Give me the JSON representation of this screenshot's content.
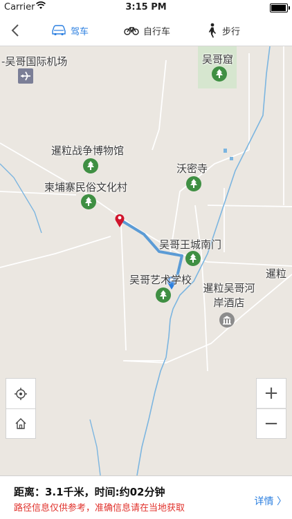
{
  "status_bar": {
    "carrier": "Carrier",
    "time": "3:15 PM",
    "battery_level": 0.95
  },
  "nav": {
    "tabs": [
      {
        "label": "驾车",
        "icon": "car-icon",
        "active": true
      },
      {
        "label": "自行车",
        "icon": "bicycle-icon",
        "active": false
      },
      {
        "label": "步行",
        "icon": "walking-person-icon",
        "active": false
      }
    ]
  },
  "map": {
    "labels": {
      "airport": "-吴哥国际机场",
      "angkor_wat": "吴哥窟",
      "war_museum": "暹粒战争博物馆",
      "wat_thmei": "沃密寺",
      "cambodian_village": "柬埔寨民俗文化村",
      "south_gate": "吴哥王城南门",
      "art_school": "吴哥艺术学校",
      "river_hotel": "暹粒吴哥河岸酒店",
      "siem_reap": "暹粒"
    },
    "controls": {
      "zoom_in": "+",
      "zoom_out": "−"
    },
    "route_color": "#5b9bd5",
    "destination_pin_color": "#d0142c",
    "origin_pin_color": "#2b7fe0"
  },
  "info": {
    "distance": "距离：3.1千米，时间:约02分钟",
    "note": "路径信息仅供参考，准确信息请在当地获取",
    "details_label": "详情 〉"
  }
}
